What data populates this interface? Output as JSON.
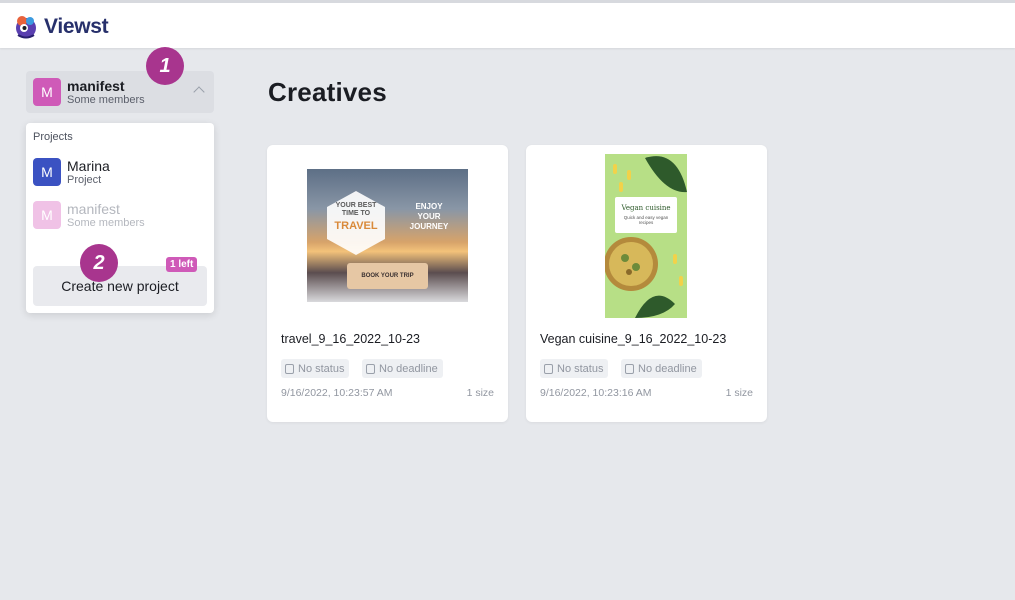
{
  "app": {
    "name": "Viewst"
  },
  "team_switcher": {
    "avatar": "M",
    "name": "manifest",
    "subtitle": "Some members",
    "icon": "chevron-up-icon"
  },
  "steps": {
    "one": "1",
    "two": "2"
  },
  "dropdown": {
    "title": "Projects",
    "projects": [
      {
        "avatar": "M",
        "name": "Marina",
        "subtitle": "Project"
      },
      {
        "avatar": "M",
        "name": "manifest",
        "subtitle": "Some members"
      }
    ],
    "create_label": "Create new project",
    "left_tag": "1 left"
  },
  "page": {
    "title": "Creatives"
  },
  "creatives": [
    {
      "name": "travel_9_16_2022_10-23",
      "status": "No status",
      "deadline": "No deadline",
      "date": "9/16/2022, 10:23:57 AM",
      "size": "1 size",
      "thumb_text": {
        "line1": "YOUR BEST",
        "line2": "TIME TO",
        "line3": "TRAVEL",
        "enjoy1": "ENJOY",
        "enjoy2": "YOUR",
        "enjoy3": "JOURNEY",
        "button": "BOOK YOUR TRIP"
      }
    },
    {
      "name": "Vegan cuisine_9_16_2022_10-23",
      "status": "No status",
      "deadline": "No deadline",
      "date": "9/16/2022, 10:23:16 AM",
      "size": "1 size",
      "thumb_text": {
        "title": "Vegan cuisine",
        "subtitle": "Quick and easy vegan recipes"
      }
    }
  ],
  "colors": {
    "accent": "#cf5ab8",
    "step_badge": "#a8358e",
    "project_blue": "#3b52c2",
    "logo_text": "#27306b"
  }
}
